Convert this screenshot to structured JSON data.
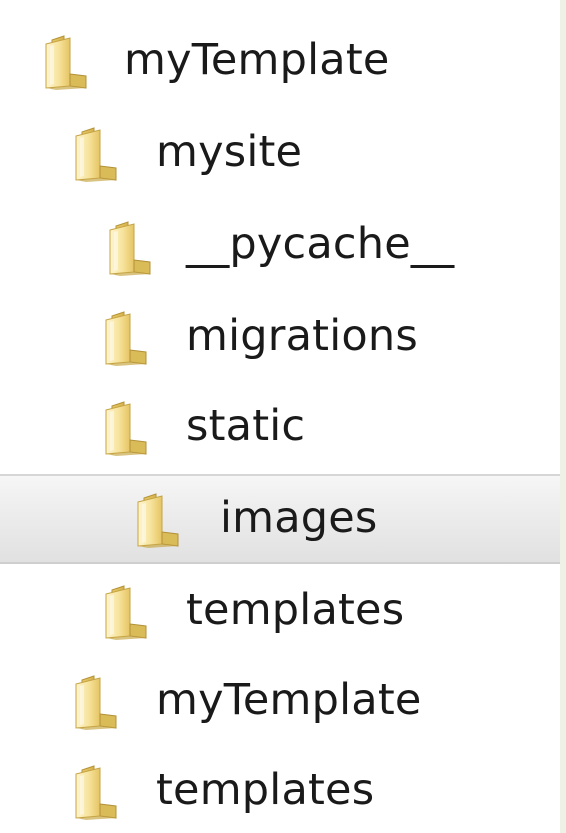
{
  "tree": {
    "items": [
      {
        "label": "myTemplate"
      },
      {
        "label": "mysite"
      },
      {
        "label": "__pycache__"
      },
      {
        "label": "migrations"
      },
      {
        "label": "static"
      },
      {
        "label": "images"
      },
      {
        "label": "templates"
      },
      {
        "label": "myTemplate"
      },
      {
        "label": "templates"
      }
    ],
    "selected_label": "images"
  },
  "colors": {
    "folder_body": "#f2dc8a",
    "folder_highlight": "#fbf0c0",
    "folder_shadow": "#c9a94a",
    "selected_row": "#e9e9e9"
  },
  "icons": {
    "folder": "folder-icon"
  }
}
